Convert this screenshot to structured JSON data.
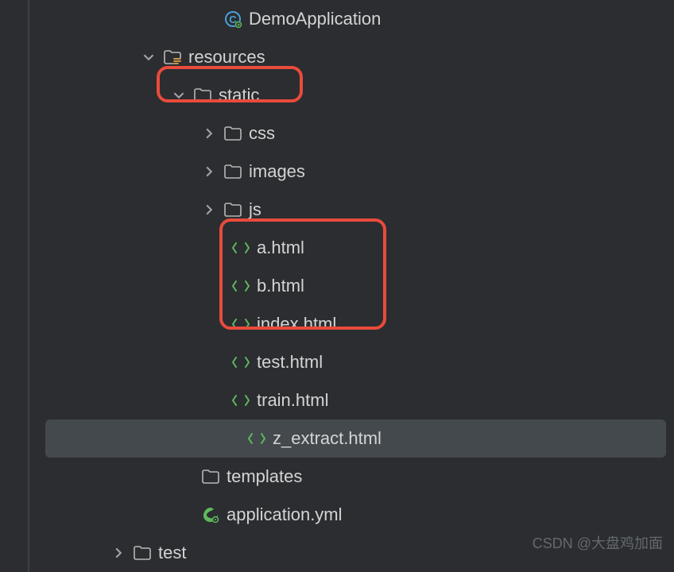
{
  "tree": {
    "demoApp": "DemoApplication",
    "resources": "resources",
    "static": "static",
    "css": "css",
    "images": "images",
    "js": "js",
    "a_html": "a.html",
    "b_html": "b.html",
    "index_html": "index.html",
    "test_html": "test.html",
    "train_html": "train.html",
    "z_extract_html": "z_extract.html",
    "templates": "templates",
    "application_yml": "application.yml",
    "test": "test"
  },
  "watermark": "CSDN @大盘鸡加面"
}
